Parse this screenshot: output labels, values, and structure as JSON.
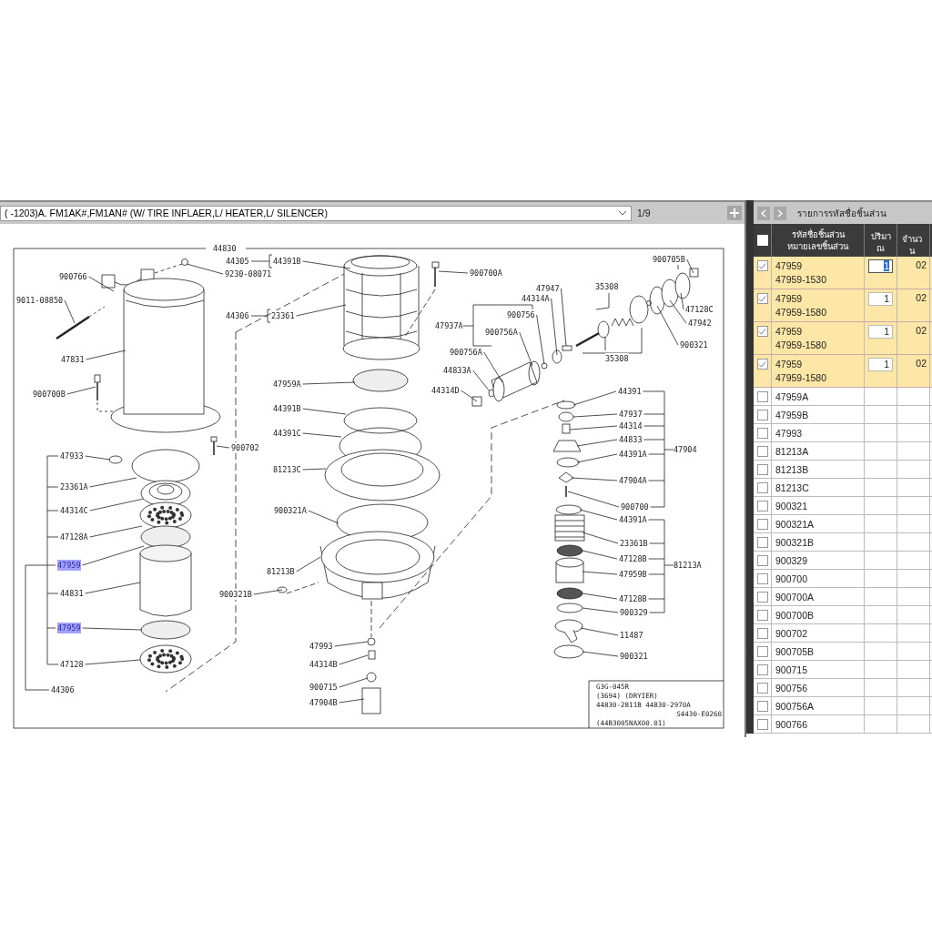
{
  "toolbar": {
    "selector_value": "( -1203)A. FM1AK#,FM1AN# (W/ TIRE INFLAER,L/ HEATER,L/ SILENCER)",
    "page": "1/9"
  },
  "diagram": {
    "labels": [
      {
        "text": "44830",
        "highlighted": false
      },
      {
        "text": "44305",
        "highlighted": false
      },
      {
        "text": "44391B",
        "highlighted": false
      },
      {
        "text": "9230-08071",
        "highlighted": false
      },
      {
        "text": "900766",
        "highlighted": false
      },
      {
        "text": "9011-08850",
        "highlighted": false
      },
      {
        "text": "44306",
        "highlighted": false
      },
      {
        "text": "23361",
        "highlighted": false
      },
      {
        "text": "47831",
        "highlighted": false
      },
      {
        "text": "900700B",
        "highlighted": false
      },
      {
        "text": "47959A",
        "highlighted": false
      },
      {
        "text": "44391B",
        "highlighted": false
      },
      {
        "text": "44391C",
        "highlighted": false
      },
      {
        "text": "900702",
        "highlighted": false
      },
      {
        "text": "47933",
        "highlighted": false
      },
      {
        "text": "81213C",
        "highlighted": false
      },
      {
        "text": "23361A",
        "highlighted": false
      },
      {
        "text": "44314C",
        "highlighted": false
      },
      {
        "text": "900321A",
        "highlighted": false
      },
      {
        "text": "47128A",
        "highlighted": false
      },
      {
        "text": "47959",
        "highlighted": true
      },
      {
        "text": "81213B",
        "highlighted": false
      },
      {
        "text": "44831",
        "highlighted": false
      },
      {
        "text": "900321B",
        "highlighted": false
      },
      {
        "text": "47959",
        "highlighted": true
      },
      {
        "text": "47993",
        "highlighted": false
      },
      {
        "text": "47128",
        "highlighted": false
      },
      {
        "text": "44314B",
        "highlighted": false
      },
      {
        "text": "44306",
        "highlighted": false
      },
      {
        "text": "900715",
        "highlighted": false
      },
      {
        "text": "47904B",
        "highlighted": false
      },
      {
        "text": "900700A",
        "highlighted": false
      },
      {
        "text": "900705B",
        "highlighted": false
      },
      {
        "text": "47947",
        "highlighted": false
      },
      {
        "text": "35308",
        "highlighted": false
      },
      {
        "text": "44314A",
        "highlighted": false
      },
      {
        "text": "47128C",
        "highlighted": false
      },
      {
        "text": "900756",
        "highlighted": false
      },
      {
        "text": "47937A",
        "highlighted": false
      },
      {
        "text": "47942",
        "highlighted": false
      },
      {
        "text": "900756A",
        "highlighted": false
      },
      {
        "text": "900321",
        "highlighted": false
      },
      {
        "text": "900756A",
        "highlighted": false
      },
      {
        "text": "35308",
        "highlighted": false
      },
      {
        "text": "44833A",
        "highlighted": false
      },
      {
        "text": "44314D",
        "highlighted": false
      },
      {
        "text": "44391",
        "highlighted": false
      },
      {
        "text": "47937",
        "highlighted": false
      },
      {
        "text": "44314",
        "highlighted": false
      },
      {
        "text": "44833",
        "highlighted": false
      },
      {
        "text": "44391A",
        "highlighted": false
      },
      {
        "text": "47904",
        "highlighted": false
      },
      {
        "text": "47904A",
        "highlighted": false
      },
      {
        "text": "900700",
        "highlighted": false
      },
      {
        "text": "44391A",
        "highlighted": false
      },
      {
        "text": "23361B",
        "highlighted": false
      },
      {
        "text": "47128B",
        "highlighted": false
      },
      {
        "text": "81213A",
        "highlighted": false
      },
      {
        "text": "47959B",
        "highlighted": false
      },
      {
        "text": "47128B",
        "highlighted": false
      },
      {
        "text": "900329",
        "highlighted": false
      },
      {
        "text": "11487",
        "highlighted": false
      },
      {
        "text": "900321",
        "highlighted": false
      }
    ],
    "info_block": [
      "G3G-045R",
      "(3694) (DRYIER)",
      "44830-2811B 44830-2970A",
      "S4430-E0260",
      "(44B3005NAX00.01)"
    ]
  },
  "parts_panel": {
    "title": "รายการรหัสชื่อชิ้นส่วน",
    "select_all_checked": false,
    "columns": [
      [
        "รหัสชื่อชิ้นส่วน",
        "หมายเลขชิ้นส่วน"
      ],
      [
        "ปริมา",
        "ณ"
      ],
      [
        "จำนว",
        "น"
      ]
    ],
    "rows": [
      {
        "checked": true,
        "code": "47959",
        "part_number": "47959-1530",
        "quantity": "1",
        "count": "02",
        "focused": true
      },
      {
        "checked": true,
        "code": "47959",
        "part_number": "47959-1580",
        "quantity": "1",
        "count": "02",
        "focused": false
      },
      {
        "checked": true,
        "code": "47959",
        "part_number": "47959-1580",
        "quantity": "1",
        "count": "02",
        "focused": false
      },
      {
        "checked": true,
        "code": "47959",
        "part_number": "47959-1580",
        "quantity": "1",
        "count": "02",
        "focused": false
      },
      {
        "checked": false,
        "code": "47959A"
      },
      {
        "checked": false,
        "code": "47959B"
      },
      {
        "checked": false,
        "code": "47993"
      },
      {
        "checked": false,
        "code": "81213A"
      },
      {
        "checked": false,
        "code": "81213B"
      },
      {
        "checked": false,
        "code": "81213C"
      },
      {
        "checked": false,
        "code": "900321"
      },
      {
        "checked": false,
        "code": "900321A"
      },
      {
        "checked": false,
        "code": "900321B"
      },
      {
        "checked": false,
        "code": "900329"
      },
      {
        "checked": false,
        "code": "900700"
      },
      {
        "checked": false,
        "code": "900700A"
      },
      {
        "checked": false,
        "code": "900700B"
      },
      {
        "checked": false,
        "code": "900702"
      },
      {
        "checked": false,
        "code": "900705B"
      },
      {
        "checked": false,
        "code": "900715"
      },
      {
        "checked": false,
        "code": "900756"
      },
      {
        "checked": false,
        "code": "900756A"
      },
      {
        "checked": false,
        "code": "900766"
      }
    ]
  }
}
